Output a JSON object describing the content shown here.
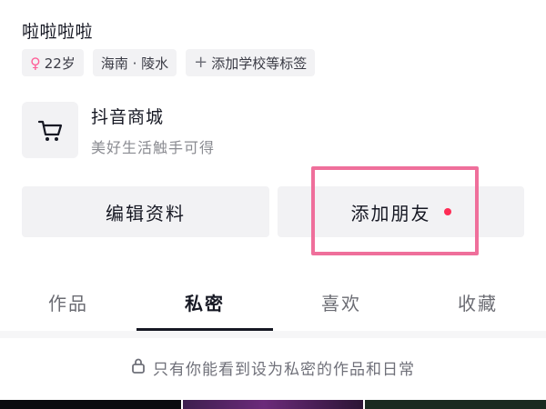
{
  "profile": {
    "bio": "啦啦啦啦",
    "tags": [
      {
        "icon": "female-icon",
        "label": "22岁"
      },
      {
        "label": "海南 · 陵水"
      },
      {
        "icon": "plus-icon",
        "label": "添加学校等标签"
      }
    ]
  },
  "shop": {
    "icon": "cart-icon",
    "title": "抖音商城",
    "subtitle": "美好生活触手可得"
  },
  "actions": {
    "edit_label": "编辑资料",
    "add_friend_label": "添加朋友",
    "notification_dot_color": "#fe2c55",
    "highlight_color": "#ef6f9b"
  },
  "tabs": [
    {
      "label": "作品",
      "active": false
    },
    {
      "label": "私密",
      "active": true
    },
    {
      "label": "喜欢",
      "active": false
    },
    {
      "label": "收藏",
      "active": false
    }
  ],
  "private_notice": {
    "icon": "lock-icon",
    "text": "只有你能看到设为私密的作品和日常"
  }
}
